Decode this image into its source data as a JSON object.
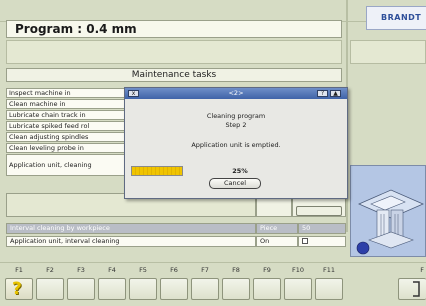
{
  "header": {
    "program_title": "Program : 0.4 mm",
    "logo_text": "BRANDT"
  },
  "maintenance": {
    "title": "Maintenance tasks",
    "tasks": [
      "Inspect machine in",
      "Clean machine in",
      "Lubricate chain track in",
      "Lubricate spiked feed rol",
      "Clean adjusting spindles",
      "Clean leveling probe in",
      "Application unit, cleaning"
    ]
  },
  "grid": {
    "rows": [
      {
        "label": "Interval cleaning by workpiece",
        "unit": "Piece",
        "value": "50",
        "selected": true
      },
      {
        "label": "Application unit, interval cleaning",
        "unit": "On",
        "value": "",
        "selected": false
      }
    ]
  },
  "dialog": {
    "title": "<2>",
    "menu_icon": "x",
    "help_label": "?",
    "up_label": "▲",
    "line1": "Cleaning program",
    "line2": "Step 2",
    "line3": "Application unit is emptied.",
    "progress_percent": 25,
    "progress_text": "25%",
    "cancel_label": "Cancel"
  },
  "function_keys": {
    "labels": [
      "F1",
      "F2",
      "F3",
      "F4",
      "F5",
      "F6",
      "F7",
      "F8",
      "F9",
      "F10",
      "F11",
      "F"
    ],
    "help_glyph": "?"
  },
  "colors": {
    "background": "#d6dcc4",
    "dialog_titlebar": "#3f63a8",
    "progress_fill": "#f0c400",
    "selected_row": "#b9bdc6",
    "machine_panel": "#b4c6e4"
  }
}
